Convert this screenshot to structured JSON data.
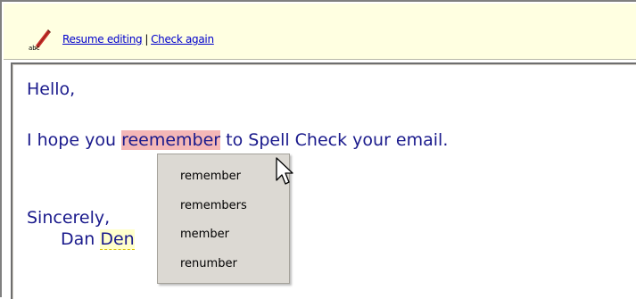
{
  "toolbar": {
    "spell_icon": "spellcheck-abc-icon",
    "resume_label": "Resume editing",
    "separator": "|",
    "check_again_label": "Check again"
  },
  "editor": {
    "line1": "Hello,",
    "line2_before": "I hope you ",
    "line2_misspelled": "reemember",
    "line2_after": " to Spell Check your email.",
    "line3": "Sincerely,",
    "line4_prefix": "Dan ",
    "line4_flagged": "Den"
  },
  "suggestions": [
    "remember",
    "remembers",
    "member",
    "renumber"
  ],
  "colors": {
    "toolbar_bg": "#ffffe1",
    "text": "#1a1a8c",
    "misspelled_highlight": "#f4b7b7",
    "menu_bg": "#dcd9d3"
  }
}
